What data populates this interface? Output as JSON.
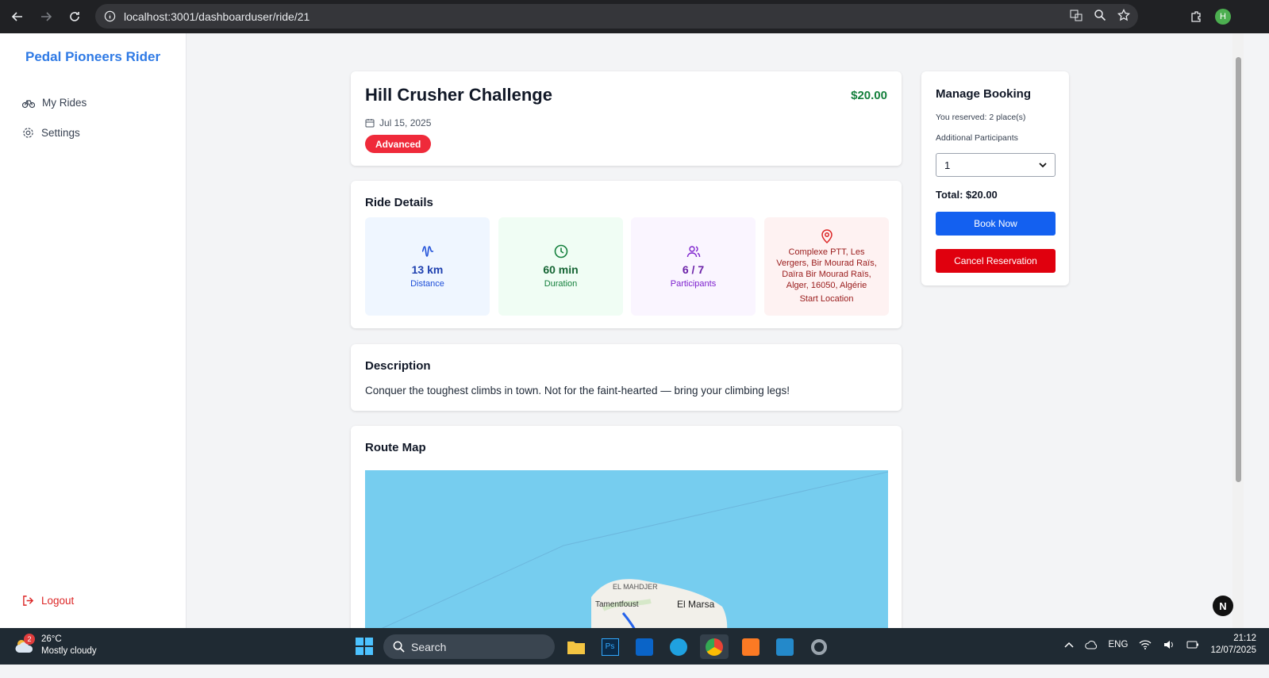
{
  "browser": {
    "url": "localhost:3001/dashboarduser/ride/21",
    "profile_initial": "H"
  },
  "sidebar": {
    "brand": "Pedal Pioneers Rider",
    "items": [
      {
        "label": "My Rides",
        "icon": "bike-icon"
      },
      {
        "label": "Settings",
        "icon": "gear-icon"
      }
    ],
    "logout": "Logout"
  },
  "ride": {
    "title": "Hill Crusher Challenge",
    "price": "$20.00",
    "date": "Jul 15, 2025",
    "level": "Advanced"
  },
  "details": {
    "title": "Ride Details",
    "stats": [
      {
        "value": "13 km",
        "label": "Distance",
        "icon": "wave-icon"
      },
      {
        "value": "60 min",
        "label": "Duration",
        "icon": "clock-icon"
      },
      {
        "value": "6 / 7",
        "label": "Participants",
        "icon": "users-icon"
      },
      {
        "value": "Complexe PTT, Les Vergers, Bir Mourad Raïs, Daïra Bir Mourad Raïs, Alger, 16050, Algérie",
        "label": "Start Location",
        "icon": "map-pin-icon"
      }
    ]
  },
  "description": {
    "title": "Description",
    "text": "Conquer the toughest climbs in town. Not for the faint-hearted — bring your climbing legs!"
  },
  "route_map": {
    "title": "Route Map",
    "labels": [
      "EL MAHDJER",
      "Tamentfoust",
      "El Marsa"
    ]
  },
  "booking": {
    "title": "Manage Booking",
    "reserved": "You reserved: 2 place(s)",
    "additional_label": "Additional Participants",
    "selected_value": "1",
    "total": "Total: $20.00",
    "book_label": "Book Now",
    "cancel_label": "Cancel Reservation"
  },
  "next_badge": "N",
  "taskbar": {
    "weather_badge": "2",
    "temperature": "26°C",
    "weather": "Mostly cloudy",
    "search": "Search",
    "lang": "ENG",
    "time": "21:12",
    "date": "12/07/2025"
  },
  "colors": {
    "brand": "#2f7ae5",
    "price": "#15803d",
    "level": "#ef2a3a",
    "book": "#1360f0",
    "cancel": "#e0000e"
  }
}
